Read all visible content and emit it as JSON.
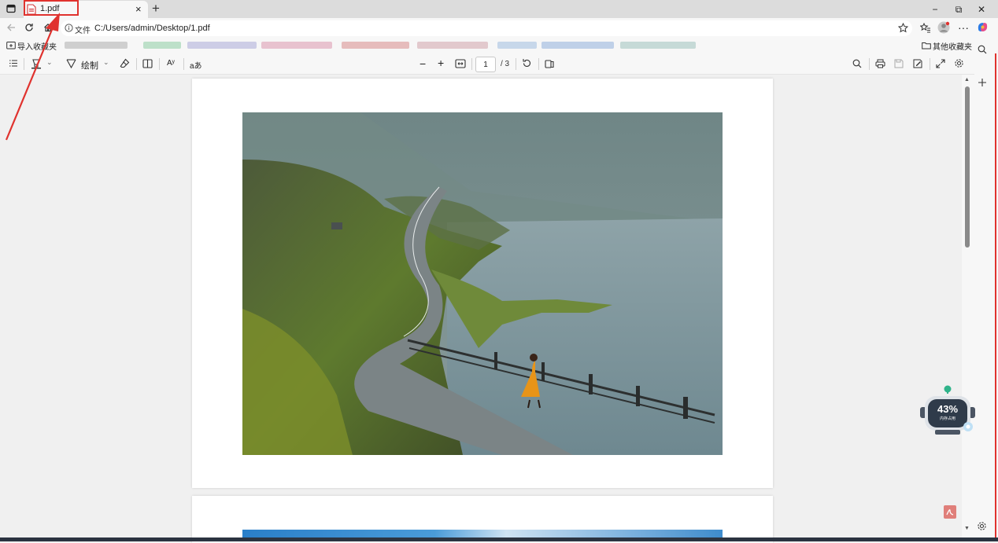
{
  "tab": {
    "title": "1.pdf",
    "new_tab": "+",
    "close": "×"
  },
  "window_controls": {
    "minimize": "−",
    "restore": "⧉",
    "close": "✕"
  },
  "address_bar": {
    "label": "文件",
    "url": "C:/Users/admin/Desktop/1.pdf"
  },
  "favorites_bar": {
    "import_label": "导入收藏夹",
    "other_label": "其他收藏夹",
    "blurred_colors": [
      "#c8c8c8",
      "#b9dfc7",
      "#c9c9e6",
      "#e8b9c8",
      "#e6b7b7",
      "#d8d8d8",
      "#b9cde8",
      "#c3d6cf",
      "#d6d6d6",
      "#bfd8e8"
    ]
  },
  "pdf_toolbar": {
    "draw_label": "绘制",
    "read_aloud": "Aʸ",
    "translate": "aあ",
    "zoom_out": "−",
    "zoom_in": "+",
    "current_page": "1",
    "total_pages": "/ 3"
  },
  "memory_widget": {
    "percent": "43%",
    "caption": "内存占用"
  },
  "colors": {
    "accent_red": "#e0322e",
    "viewer_bg": "#f0f0f0"
  }
}
